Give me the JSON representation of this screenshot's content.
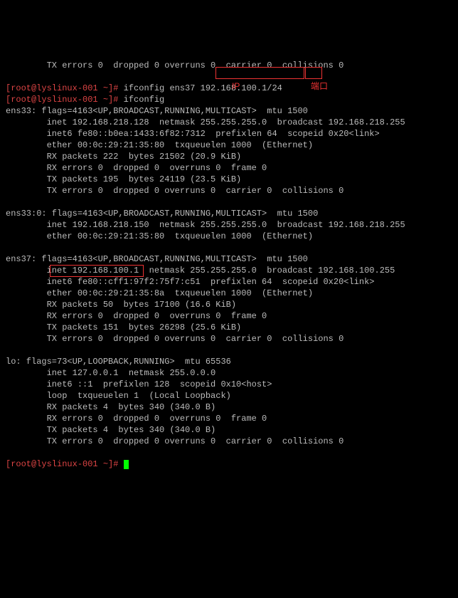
{
  "top_partial": "        TX errors 0  dropped 0 overruns 0  carrier 0  collisions 0",
  "cmd1": {
    "prompt": "[root@lyslinux-001 ~]# ",
    "command": "ifconfig ens37 192.168.100.1/24"
  },
  "cmd2": {
    "prompt": "[root@lyslinux-001 ~]# ",
    "command": "ifconfig"
  },
  "ens33": {
    "header": "ens33: flags=4163<UP,BROADCAST,RUNNING,MULTICAST>  mtu 1500",
    "inet": "        inet 192.168.218.128  netmask 255.255.255.0  broadcast 192.168.218.255",
    "inet6": "        inet6 fe80::b0ea:1433:6f82:7312  prefixlen 64  scopeid 0x20<link>",
    "ether": "        ether 00:0c:29:21:35:80  txqueuelen 1000  (Ethernet)",
    "rxp": "        RX packets 222  bytes 21502 (20.9 KiB)",
    "rxe": "        RX errors 0  dropped 0  overruns 0  frame 0",
    "txp": "        TX packets 195  bytes 24119 (23.5 KiB)",
    "txe": "        TX errors 0  dropped 0 overruns 0  carrier 0  collisions 0"
  },
  "ens33_0": {
    "header": "ens33:0: flags=4163<UP,BROADCAST,RUNNING,MULTICAST>  mtu 1500",
    "inet": "        inet 192.168.218.150  netmask 255.255.255.0  broadcast 192.168.218.255",
    "ether": "        ether 00:0c:29:21:35:80  txqueuelen 1000  (Ethernet)"
  },
  "ens37": {
    "header": "ens37: flags=4163<UP,BROADCAST,RUNNING,MULTICAST>  mtu 1500",
    "inet_pre": "        ",
    "inet_box": "inet 192.168.100.1",
    "inet_post": "  netmask 255.255.255.0  broadcast 192.168.100.255",
    "inet6": "        inet6 fe80::cff1:97f2:75f7:c51  prefixlen 64  scopeid 0x20<link>",
    "ether": "        ether 00:0c:29:21:35:8a  txqueuelen 1000  (Ethernet)",
    "rxp": "        RX packets 50  bytes 17100 (16.6 KiB)",
    "rxe": "        RX errors 0  dropped 0  overruns 0  frame 0",
    "txp": "        TX packets 151  bytes 26298 (25.6 KiB)",
    "txe": "        TX errors 0  dropped 0 overruns 0  carrier 0  collisions 0"
  },
  "lo": {
    "header": "lo: flags=73<UP,LOOPBACK,RUNNING>  mtu 65536",
    "inet": "        inet 127.0.0.1  netmask 255.0.0.0",
    "inet6": "        inet6 ::1  prefixlen 128  scopeid 0x10<host>",
    "loop": "        loop  txqueuelen 1  (Local Loopback)",
    "rxp": "        RX packets 4  bytes 340 (340.0 B)",
    "rxe": "        RX errors 0  dropped 0  overruns 0  frame 0",
    "txp": "        TX packets 4  bytes 340 (340.0 B)",
    "txe": "        TX errors 0  dropped 0 overruns 0  carrier 0  collisions 0"
  },
  "final": {
    "prompt": "[root@lyslinux-001 ~]# "
  },
  "annot": {
    "ip_label": "IP",
    "port_label": "端口"
  }
}
